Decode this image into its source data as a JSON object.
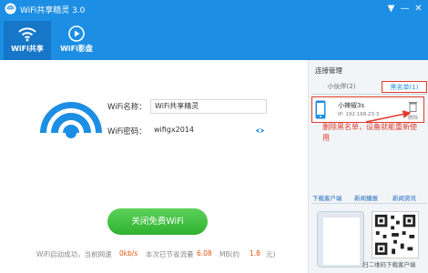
{
  "window": {
    "title": "WiFi共享精灵 3.0",
    "controls": [
      "▼",
      "—",
      "✕"
    ]
  },
  "tabs": [
    {
      "label": "WiFi共享",
      "icon": "wifi-signal-icon",
      "active": true
    },
    {
      "label": "WiFi影盘",
      "icon": "play-circle-icon",
      "active": false
    }
  ],
  "form": {
    "name_label": "WiFi名称：",
    "name_value": "WiFi共享精灵",
    "password_label": "WiFi密码：",
    "password_value": "wifigx2014"
  },
  "main_button": "关闭免费WiFi",
  "status": {
    "prefix": "WiFi启动成功，当前网速",
    "speed": "0kb/s",
    "saved_label": "本次已节省流量",
    "saved_value": "6.08",
    "unit": "MB(约",
    "yuan": "1.8",
    "yuan_suffix": "元)"
  },
  "sidebar": {
    "title": "连接管理",
    "tabs": [
      "小伙伴(2)",
      "黑名单(1)"
    ],
    "device": {
      "name": "小辣椒3s",
      "ip": "IP: 192.168.23.3",
      "action_label": "删除"
    },
    "annotation": "删除黑名单，设备就能重新使用",
    "nav": [
      "下载客户端",
      "新闻播报",
      "新闻资讯"
    ],
    "promo_caption": "扫二维码下载客户端"
  },
  "colors": {
    "brand_blue": "#1c8ee3",
    "active_tab": "#1676c8",
    "button_green": "#2eb12e",
    "accent_red": "#e03b2c",
    "stat_orange": "#e8540e"
  }
}
